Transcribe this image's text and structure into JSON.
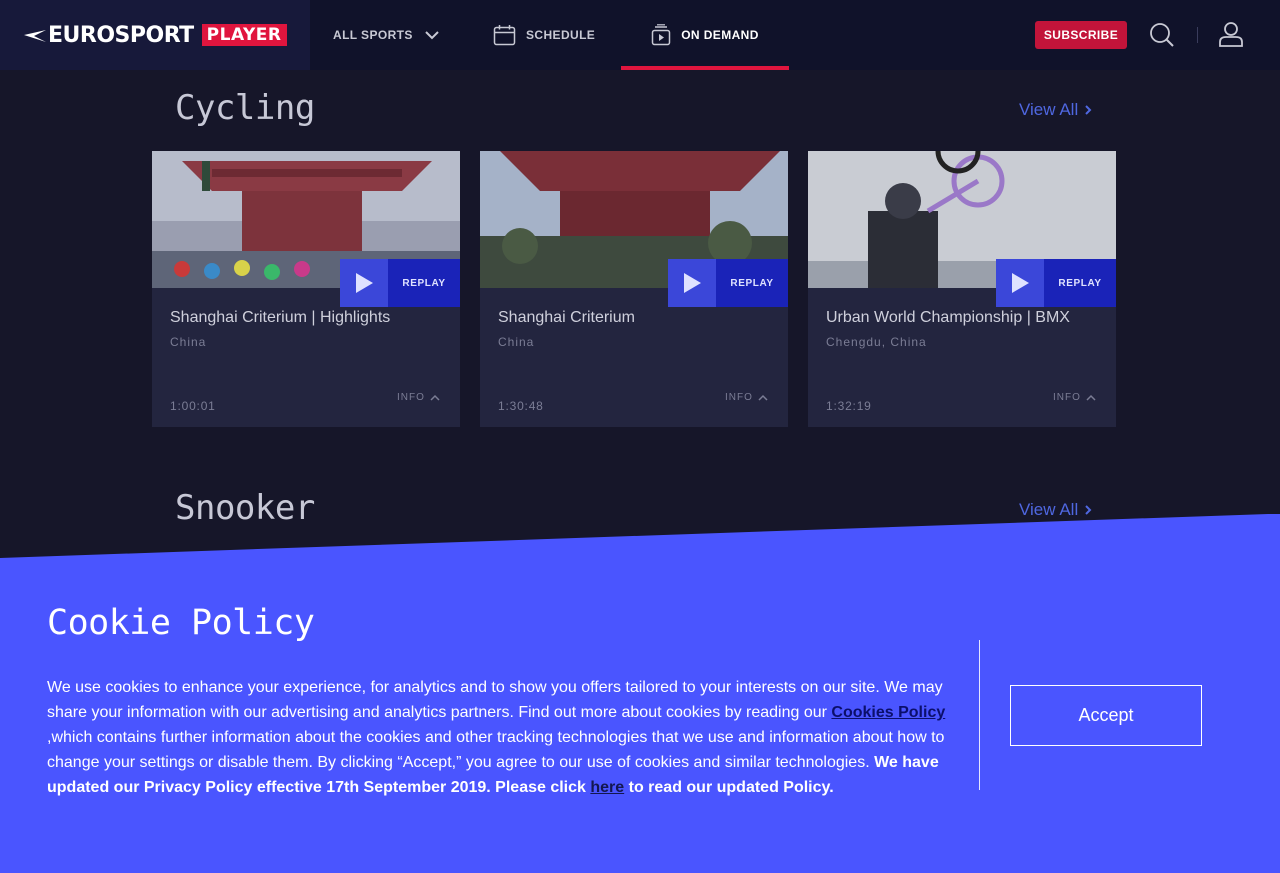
{
  "header": {
    "logo_text": "EUROSPORT",
    "logo_badge": "PLAYER",
    "nav": {
      "all_sports": "ALL SPORTS",
      "schedule": "SCHEDULE",
      "on_demand": "ON DEMAND"
    },
    "subscribe": "SUBSCRIBE",
    "colors": {
      "accent": "#e0153e",
      "bar": "#10122a"
    }
  },
  "sections": [
    {
      "title": "Cycling",
      "view_all": "View All",
      "cards": [
        {
          "title": "Shanghai Criterium | Highlights",
          "location": "China",
          "duration": "1:00:01",
          "tag": "REPLAY",
          "info": "INFO",
          "icon": "play-icon"
        },
        {
          "title": "Shanghai Criterium",
          "location": "China",
          "duration": "1:30:48",
          "tag": "REPLAY",
          "info": "INFO",
          "icon": "play-icon"
        },
        {
          "title": "Urban World Championship | BMX",
          "location": "Chengdu, China",
          "duration": "1:32:19",
          "tag": "REPLAY",
          "info": "INFO",
          "icon": "play-icon"
        }
      ]
    },
    {
      "title": "Snooker",
      "view_all": "View All"
    }
  ],
  "cookie": {
    "title": "Cookie Policy",
    "text_1": "We use cookies to enhance your experience, for analytics and to show you offers tailored to your interests on our site. We may share your information with our advertising and analytics partners. Find out more about cookies by reading our ",
    "link_policy": "Cookies Policy",
    "text_2": " ,which contains further information about the cookies and other tracking technologies that we use and information about how to change your settings or disable them. By clicking “Accept,” you agree to our use of cookies and similar technologies. ",
    "bold_1": "We have updated our Privacy Policy effective 17th September 2019. Please click ",
    "link_here": "here",
    "bold_2": " to read our updated Policy.",
    "accept": "Accept",
    "colors": {
      "banner": "#4a55ff"
    }
  }
}
